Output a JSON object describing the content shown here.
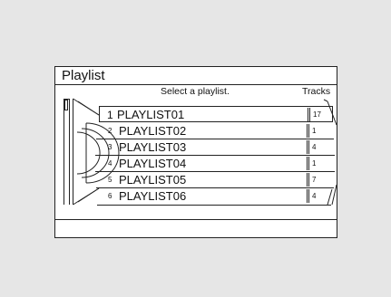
{
  "window": {
    "title": "Playlist",
    "column_headers": {
      "select": "Select a playlist.",
      "tracks": "Tracks"
    }
  },
  "playlists": [
    {
      "number": "1",
      "name": "PLAYLIST01",
      "tracks": "17",
      "selected": true
    },
    {
      "number": "2",
      "name": "PLAYLIST02",
      "tracks": "1"
    },
    {
      "number": "3",
      "name": "PLAYLIST03",
      "tracks": "4"
    },
    {
      "number": "4",
      "name": "PLAYLIST04",
      "tracks": "1"
    },
    {
      "number": "5",
      "name": "PLAYLIST05",
      "tracks": "7"
    },
    {
      "number": "6",
      "name": "PLAYLIST06",
      "tracks": "4"
    }
  ],
  "icons": {
    "scrollbar": "scrollbar-icon",
    "dial": "dial-icon"
  }
}
